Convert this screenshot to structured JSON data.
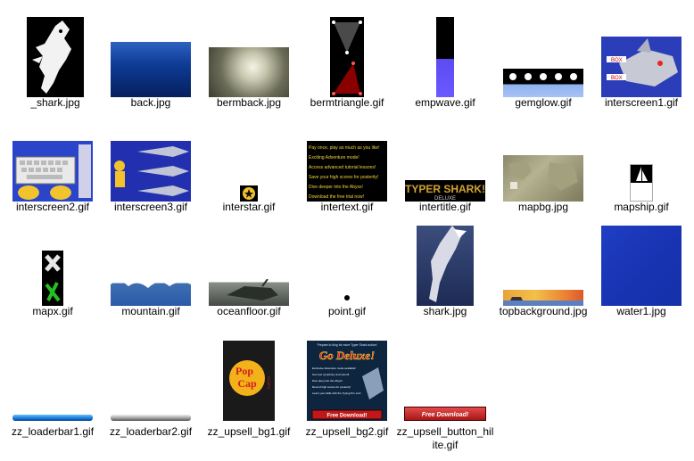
{
  "files": [
    {
      "name": "_shark.jpg"
    },
    {
      "name": "back.jpg"
    },
    {
      "name": "bermback.jpg"
    },
    {
      "name": "bermtriangle.gif"
    },
    {
      "name": "empwave.gif"
    },
    {
      "name": "gemglow.gif"
    },
    {
      "name": "interscreen1.gif"
    },
    {
      "name": "interscreen2.gif"
    },
    {
      "name": "interscreen3.gif"
    },
    {
      "name": "interstar.gif"
    },
    {
      "name": "intertext.gif"
    },
    {
      "name": "intertitle.gif"
    },
    {
      "name": "mapbg.jpg"
    },
    {
      "name": "mapship.gif"
    },
    {
      "name": "mapx.gif"
    },
    {
      "name": "mountain.gif"
    },
    {
      "name": "oceanfloor.gif"
    },
    {
      "name": "point.gif"
    },
    {
      "name": "shark.jpg"
    },
    {
      "name": "topbackground.jpg"
    },
    {
      "name": "water1.jpg"
    },
    {
      "name": "zz_loaderbar1.gif"
    },
    {
      "name": "zz_loaderbar2.gif"
    },
    {
      "name": "zz_upsell_bg1.gif"
    },
    {
      "name": "zz_upsell_bg2.gif"
    },
    {
      "name": "zz_upsell_button_hilite.gif"
    }
  ],
  "thumb_text": {
    "interscreen1_tag1": "BOX",
    "interscreen1_tag2": "BOX",
    "intertext_lines": [
      "Pay once, play as much as you like!",
      "Exciting Adventure mode!",
      "Access advanced tutorial lessons!",
      "Save your high scores for posterity!",
      "Dive deeper into the Abyss!",
      "Download the free trial now!"
    ],
    "intertitle_main": "TYPER SHARK!",
    "intertitle_sub": "DELUXE",
    "upsell1_logo_line1": "Pop",
    "upsell1_logo_line2": "Cap",
    "upsell1_logo_side": "GAMES",
    "upsell2_title": "Go Deluxe!",
    "upsell2_intro": "Prepare to blog for more Typer Shark action!",
    "upsell2_items": [
      "Exclusive Adventure mode available!",
      "Get new symphony and sound!",
      "Dive deep into the Abyss!",
      "Record high scores for posterity!",
      "Learn your skills with the Typing Pro tool!"
    ],
    "upsell2_button": "Free Download!",
    "upsellbtn_label": "Free Download!"
  },
  "colors": {
    "selection": "#cce8ff",
    "text": "#000000"
  }
}
